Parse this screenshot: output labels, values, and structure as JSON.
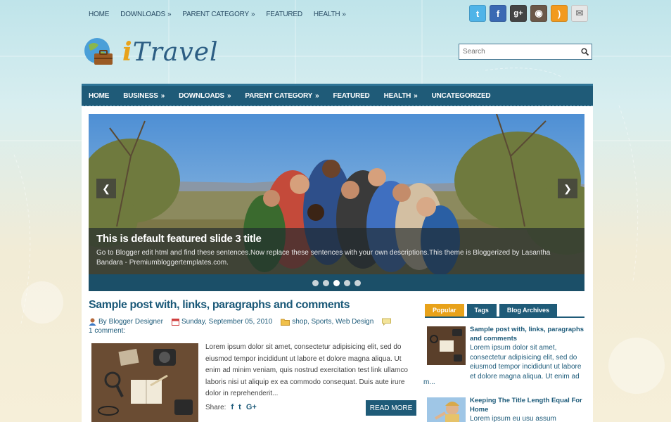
{
  "top_nav": {
    "items": [
      {
        "label": "HOME",
        "arrow": ""
      },
      {
        "label": "DOWNLOADS",
        "arrow": "»"
      },
      {
        "label": "PARENT CATEGORY",
        "arrow": "»"
      },
      {
        "label": "FEATURED",
        "arrow": ""
      },
      {
        "label": "HEALTH",
        "arrow": "»"
      }
    ]
  },
  "social": [
    {
      "name": "twitter-icon",
      "color": "#4fb4e8",
      "glyph": "t"
    },
    {
      "name": "facebook-icon",
      "color": "#3a69b3",
      "glyph": "f"
    },
    {
      "name": "google-plus-icon",
      "color": "#444444",
      "glyph": "g+"
    },
    {
      "name": "instagram-icon",
      "color": "#6b5848",
      "glyph": "◉"
    },
    {
      "name": "rss-icon",
      "color": "#f29a1e",
      "glyph": ")"
    },
    {
      "name": "email-icon",
      "color": "#e6e6e6",
      "glyph": "✉"
    }
  ],
  "logo": {
    "i": "i",
    "rest": "Travel"
  },
  "search": {
    "placeholder": "Search"
  },
  "main_nav": {
    "items": [
      {
        "label": "HOME",
        "arrow": ""
      },
      {
        "label": "BUSINESS",
        "arrow": "»"
      },
      {
        "label": "DOWNLOADS",
        "arrow": "»"
      },
      {
        "label": "PARENT CATEGORY",
        "arrow": "»"
      },
      {
        "label": "FEATURED",
        "arrow": ""
      },
      {
        "label": "HEALTH",
        "arrow": "»"
      },
      {
        "label": "UNCATEGORIZED",
        "arrow": ""
      }
    ]
  },
  "slider": {
    "title": "This is default featured slide 3 title",
    "description": "Go to Blogger edit html and find these sentences.Now replace these sentences with your own descriptions.This theme is Bloggerized by Lasantha Bandara - Premiumbloggertemplates.com.",
    "dots": 5,
    "active_dot": 3,
    "prev": "❮",
    "next": "❯"
  },
  "post": {
    "title": "Sample post with, links, paragraphs and comments",
    "author_prefix": "By",
    "author": "Blogger Designer",
    "date": "Sunday, September 05, 2010",
    "labels": "shop, Sports, Web Design",
    "comments": "1 comment:",
    "excerpt": "Lorem ipsum dolor sit amet, consectetur adipisicing elit, sed do eiusmod tempor incididunt ut labore et dolore magna aliqua. Ut enim ad minim veniam, quis nostrud exercitation test link ullamco laboris nisi ut aliquip ex ea commodo consequat. Duis aute irure dolor in reprehenderit...",
    "share_label": "Share:",
    "share_icons": {
      "facebook": "f",
      "twitter": "t",
      "google": "G+"
    },
    "read_more": "READ MORE"
  },
  "sidebar": {
    "tabs": [
      "Popular",
      "Tags",
      "Blog Archives"
    ],
    "active_tab": 0,
    "posts": [
      {
        "title": "Sample post with, links, paragraphs and comments",
        "excerpt": "Lorem ipsum dolor sit amet, consectetur adipisicing elit, sed do eiusmod tempor incididunt ut labore et dolore magna aliqua. Ut enim ad",
        "more": "m..."
      },
      {
        "title": "Keeping The Title Length Equal For Home",
        "excerpt": "Lorem ipsum eu usu assum",
        "more": ""
      }
    ]
  },
  "colors": {
    "accent": "#1f5b78",
    "active_tab": "#e8a21a",
    "link": "#1c5a79"
  }
}
